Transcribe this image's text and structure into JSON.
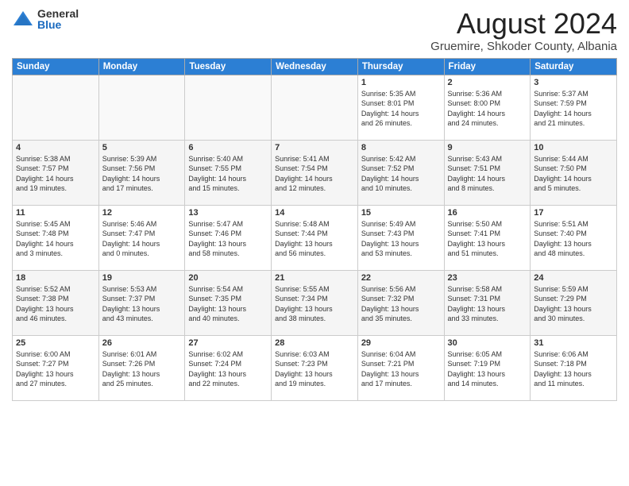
{
  "logo": {
    "general": "General",
    "blue": "Blue"
  },
  "header": {
    "month": "August 2024",
    "location": "Gruemire, Shkoder County, Albania"
  },
  "weekdays": [
    "Sunday",
    "Monday",
    "Tuesday",
    "Wednesday",
    "Thursday",
    "Friday",
    "Saturday"
  ],
  "weeks": [
    [
      {
        "day": "",
        "info": ""
      },
      {
        "day": "",
        "info": ""
      },
      {
        "day": "",
        "info": ""
      },
      {
        "day": "",
        "info": ""
      },
      {
        "day": "1",
        "info": "Sunrise: 5:35 AM\nSunset: 8:01 PM\nDaylight: 14 hours\nand 26 minutes."
      },
      {
        "day": "2",
        "info": "Sunrise: 5:36 AM\nSunset: 8:00 PM\nDaylight: 14 hours\nand 24 minutes."
      },
      {
        "day": "3",
        "info": "Sunrise: 5:37 AM\nSunset: 7:59 PM\nDaylight: 14 hours\nand 21 minutes."
      }
    ],
    [
      {
        "day": "4",
        "info": "Sunrise: 5:38 AM\nSunset: 7:57 PM\nDaylight: 14 hours\nand 19 minutes."
      },
      {
        "day": "5",
        "info": "Sunrise: 5:39 AM\nSunset: 7:56 PM\nDaylight: 14 hours\nand 17 minutes."
      },
      {
        "day": "6",
        "info": "Sunrise: 5:40 AM\nSunset: 7:55 PM\nDaylight: 14 hours\nand 15 minutes."
      },
      {
        "day": "7",
        "info": "Sunrise: 5:41 AM\nSunset: 7:54 PM\nDaylight: 14 hours\nand 12 minutes."
      },
      {
        "day": "8",
        "info": "Sunrise: 5:42 AM\nSunset: 7:52 PM\nDaylight: 14 hours\nand 10 minutes."
      },
      {
        "day": "9",
        "info": "Sunrise: 5:43 AM\nSunset: 7:51 PM\nDaylight: 14 hours\nand 8 minutes."
      },
      {
        "day": "10",
        "info": "Sunrise: 5:44 AM\nSunset: 7:50 PM\nDaylight: 14 hours\nand 5 minutes."
      }
    ],
    [
      {
        "day": "11",
        "info": "Sunrise: 5:45 AM\nSunset: 7:48 PM\nDaylight: 14 hours\nand 3 minutes."
      },
      {
        "day": "12",
        "info": "Sunrise: 5:46 AM\nSunset: 7:47 PM\nDaylight: 14 hours\nand 0 minutes."
      },
      {
        "day": "13",
        "info": "Sunrise: 5:47 AM\nSunset: 7:46 PM\nDaylight: 13 hours\nand 58 minutes."
      },
      {
        "day": "14",
        "info": "Sunrise: 5:48 AM\nSunset: 7:44 PM\nDaylight: 13 hours\nand 56 minutes."
      },
      {
        "day": "15",
        "info": "Sunrise: 5:49 AM\nSunset: 7:43 PM\nDaylight: 13 hours\nand 53 minutes."
      },
      {
        "day": "16",
        "info": "Sunrise: 5:50 AM\nSunset: 7:41 PM\nDaylight: 13 hours\nand 51 minutes."
      },
      {
        "day": "17",
        "info": "Sunrise: 5:51 AM\nSunset: 7:40 PM\nDaylight: 13 hours\nand 48 minutes."
      }
    ],
    [
      {
        "day": "18",
        "info": "Sunrise: 5:52 AM\nSunset: 7:38 PM\nDaylight: 13 hours\nand 46 minutes."
      },
      {
        "day": "19",
        "info": "Sunrise: 5:53 AM\nSunset: 7:37 PM\nDaylight: 13 hours\nand 43 minutes."
      },
      {
        "day": "20",
        "info": "Sunrise: 5:54 AM\nSunset: 7:35 PM\nDaylight: 13 hours\nand 40 minutes."
      },
      {
        "day": "21",
        "info": "Sunrise: 5:55 AM\nSunset: 7:34 PM\nDaylight: 13 hours\nand 38 minutes."
      },
      {
        "day": "22",
        "info": "Sunrise: 5:56 AM\nSunset: 7:32 PM\nDaylight: 13 hours\nand 35 minutes."
      },
      {
        "day": "23",
        "info": "Sunrise: 5:58 AM\nSunset: 7:31 PM\nDaylight: 13 hours\nand 33 minutes."
      },
      {
        "day": "24",
        "info": "Sunrise: 5:59 AM\nSunset: 7:29 PM\nDaylight: 13 hours\nand 30 minutes."
      }
    ],
    [
      {
        "day": "25",
        "info": "Sunrise: 6:00 AM\nSunset: 7:27 PM\nDaylight: 13 hours\nand 27 minutes."
      },
      {
        "day": "26",
        "info": "Sunrise: 6:01 AM\nSunset: 7:26 PM\nDaylight: 13 hours\nand 25 minutes."
      },
      {
        "day": "27",
        "info": "Sunrise: 6:02 AM\nSunset: 7:24 PM\nDaylight: 13 hours\nand 22 minutes."
      },
      {
        "day": "28",
        "info": "Sunrise: 6:03 AM\nSunset: 7:23 PM\nDaylight: 13 hours\nand 19 minutes."
      },
      {
        "day": "29",
        "info": "Sunrise: 6:04 AM\nSunset: 7:21 PM\nDaylight: 13 hours\nand 17 minutes."
      },
      {
        "day": "30",
        "info": "Sunrise: 6:05 AM\nSunset: 7:19 PM\nDaylight: 13 hours\nand 14 minutes."
      },
      {
        "day": "31",
        "info": "Sunrise: 6:06 AM\nSunset: 7:18 PM\nDaylight: 13 hours\nand 11 minutes."
      }
    ]
  ]
}
